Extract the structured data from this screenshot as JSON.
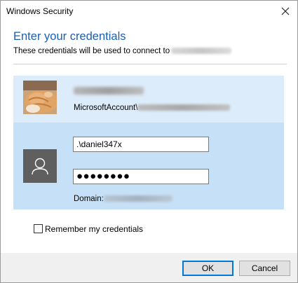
{
  "window": {
    "title": "Windows Security"
  },
  "header": {
    "heading": "Enter your credentials",
    "subheading": "These credentials will be used to connect to"
  },
  "account": {
    "id_prefix": "MicrosoftAccount\\"
  },
  "credentials": {
    "username_value": ".\\daniel347x",
    "password_mask": "●●●●●●●●",
    "domain_label": "Domain:"
  },
  "options": {
    "remember_label": "Remember my credentials",
    "remember_checked": false
  },
  "buttons": {
    "ok": "OK",
    "cancel": "Cancel"
  },
  "colors": {
    "accent": "#0078d7",
    "heading": "#1a5fb4",
    "row_hover": "#dcecfb",
    "row_selected": "#c6e0f7"
  },
  "icons": {
    "close": "close-icon",
    "generic_user": "user-icon",
    "account_photo": "cat-avatar"
  }
}
